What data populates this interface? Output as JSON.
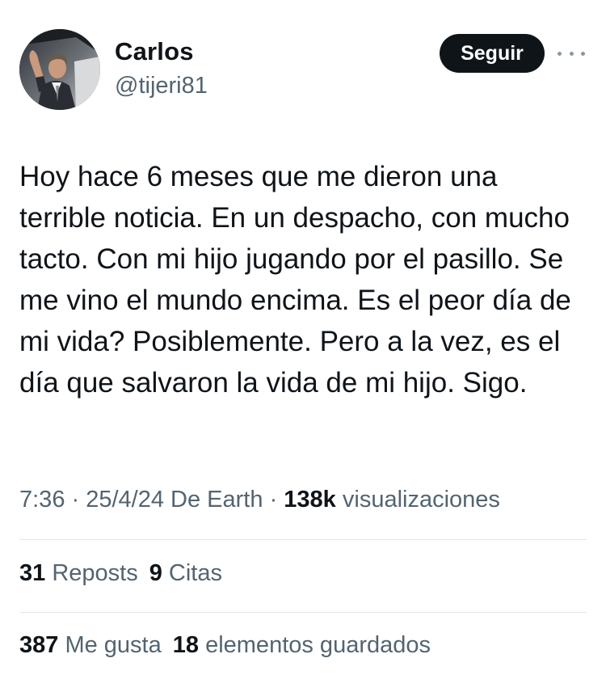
{
  "user": {
    "display_name": "Carlos",
    "handle": "@tijeri81"
  },
  "actions": {
    "follow_label": "Seguir"
  },
  "tweet": {
    "text": "Hoy hace 6 meses que me dieron una terrible noticia. En un despacho, con mucho tacto. Con mi hijo jugando por el pasillo. Se me vino el mundo encima. Es el peor día de mi vida? Posiblemente. Pero a la vez, es el día que salvaron la vida de mi hijo. Sigo."
  },
  "meta": {
    "time_date": "7:36 · 25/4/24",
    "location": "De Earth",
    "separator": "·",
    "views_count": "138k",
    "views_label": "visualizaciones"
  },
  "engagement": {
    "reposts_count": "31",
    "reposts_label": "Reposts",
    "quotes_count": "9",
    "quotes_label": "Citas",
    "likes_count": "387",
    "likes_label": "Me gusta",
    "bookmarks_count": "18",
    "bookmarks_label": "elementos guardados"
  },
  "icons": {
    "more": "more-horizontal-icon",
    "avatar": "profile-photo"
  },
  "colors": {
    "text_primary": "#0f1419",
    "text_secondary": "#536471",
    "button_bg": "#0f1419",
    "divider": "#e1e6ea"
  }
}
